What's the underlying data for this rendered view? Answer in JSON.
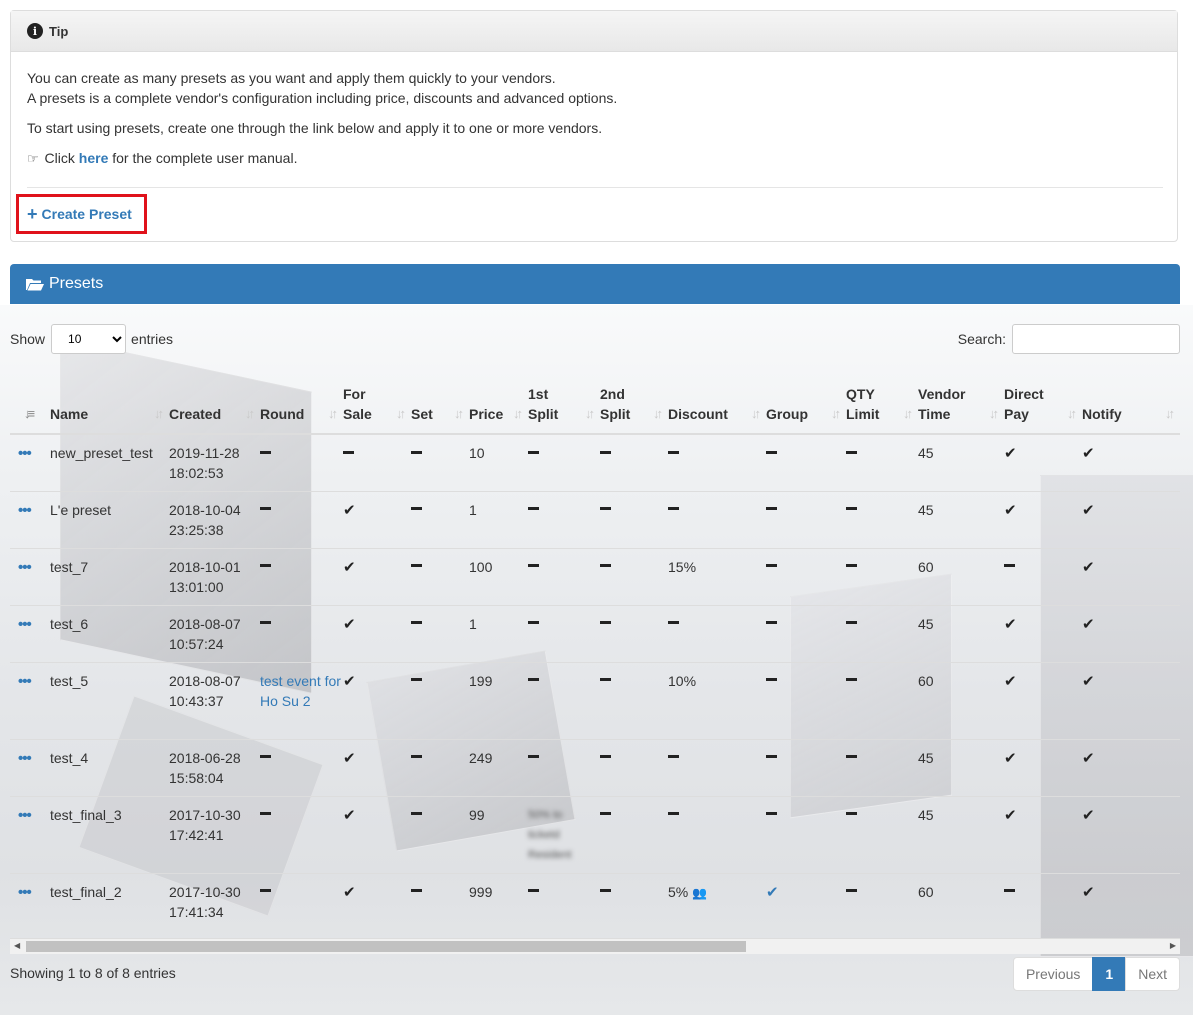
{
  "tip": {
    "title": "Tip",
    "line1": "You can create as many presets as you want and apply them quickly to your vendors.",
    "line2": "A presets is a complete vendor's configuration including price, discounts and advanced options.",
    "line3": "To start using presets, create one through the link below and apply it to one or more vendors.",
    "manual_prefix": "Click",
    "manual_link": "here",
    "manual_suffix": "for the complete user manual.",
    "create_label": "Create Preset"
  },
  "presets": {
    "title": "Presets",
    "show_label": "Show",
    "entries_label": "entries",
    "page_length": "10",
    "search_label": "Search:",
    "search_value": ""
  },
  "table": {
    "headers": {
      "name": "Name",
      "created": "Created",
      "round": "Round",
      "for_sale_1": "For",
      "for_sale_2": "Sale",
      "set": "Set",
      "price": "Price",
      "split1_1": "1st",
      "split1_2": "Split",
      "split2_1": "2nd",
      "split2_2": "Split",
      "discount": "Discount",
      "group": "Group",
      "qty_1": "QTY",
      "qty_2": "Limit",
      "vendor_1": "Vendor",
      "vendor_2": "Time",
      "direct_1": "Direct",
      "direct_2": "Pay",
      "notify": "Notify"
    },
    "rows": [
      {
        "name": "new_preset_test",
        "date": "2019-11-28",
        "time": "18:02:53",
        "round": "",
        "for_sale": false,
        "price": "10",
        "split1": "",
        "discount": "",
        "group": false,
        "vendor_time": "45",
        "direct_pay": true,
        "notify": true
      },
      {
        "name": "L'e preset",
        "date": "2018-10-04",
        "time": "23:25:38",
        "round": "",
        "for_sale": true,
        "price": "1",
        "split1": "",
        "discount": "",
        "group": false,
        "vendor_time": "45",
        "direct_pay": true,
        "notify": true
      },
      {
        "name": "test_7",
        "date": "2018-10-01",
        "time": "13:01:00",
        "round": "",
        "for_sale": true,
        "price": "100",
        "split1": "",
        "discount": "15%",
        "group": false,
        "vendor_time": "60",
        "direct_pay": false,
        "notify": true
      },
      {
        "name": "test_6",
        "date": "2018-08-07",
        "time": "10:57:24",
        "round": "",
        "for_sale": true,
        "price": "1",
        "split1": "",
        "discount": "",
        "group": false,
        "vendor_time": "45",
        "direct_pay": true,
        "notify": true
      },
      {
        "name": "test_5",
        "date": "2018-08-07",
        "time": "10:43:37",
        "round": "test event for Ho Su 2",
        "for_sale": true,
        "price": "199",
        "split1": "",
        "discount": "10%",
        "group": false,
        "vendor_time": "60",
        "direct_pay": true,
        "notify": true
      },
      {
        "name": "test_4",
        "date": "2018-06-28",
        "time": "15:58:04",
        "round": "",
        "for_sale": true,
        "price": "249",
        "split1": "",
        "discount": "",
        "group": false,
        "vendor_time": "45",
        "direct_pay": true,
        "notify": true
      },
      {
        "name": "test_final_3",
        "date": "2017-10-30",
        "time": "17:42:41",
        "round": "",
        "for_sale": true,
        "price": "99",
        "split1": "50% to",
        "split1_b": "ticketd",
        "split1_c": "Resident",
        "discount": "",
        "group": false,
        "vendor_time": "45",
        "direct_pay": true,
        "notify": true
      },
      {
        "name": "test_final_2",
        "date": "2017-10-30",
        "time": "17:41:34",
        "round": "",
        "for_sale": true,
        "price": "999",
        "split1": "",
        "discount": "5%",
        "group": true,
        "vendor_time": "60",
        "direct_pay": false,
        "notify": true
      }
    ]
  },
  "footer": {
    "info": "Showing 1 to 8 of 8 entries",
    "previous": "Previous",
    "page": "1",
    "next": "Next"
  },
  "colors": {
    "primary": "#337ab7",
    "highlight": "#e0121b"
  }
}
